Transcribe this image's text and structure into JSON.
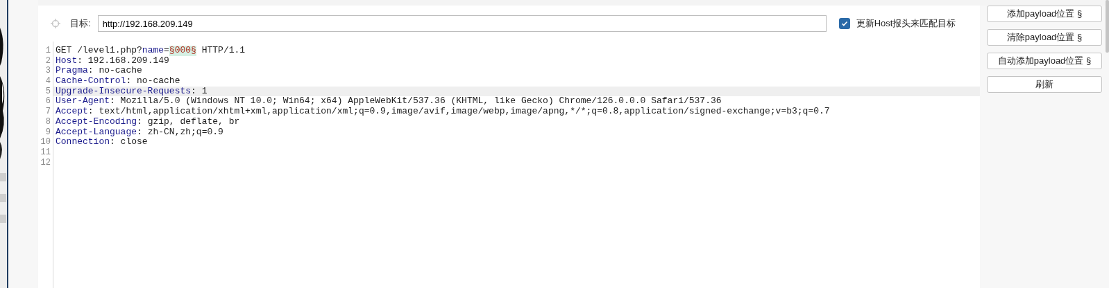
{
  "target": {
    "label": "目标:",
    "value": "http://192.168.209.149"
  },
  "update_host": {
    "label": "更新Host报头来匹配目标",
    "checked": true
  },
  "editor": {
    "lines": [
      {
        "number": "1",
        "selected": false,
        "segments": [
          {
            "kind": "text",
            "text": "GET /level1.php?"
          },
          {
            "kind": "key",
            "text": "name"
          },
          {
            "kind": "text",
            "text": "="
          },
          {
            "kind": "payload",
            "text": "§000§"
          },
          {
            "kind": "text",
            "text": " HTTP/1.1"
          }
        ]
      },
      {
        "number": "2",
        "selected": false,
        "segments": [
          {
            "kind": "key",
            "text": "Host"
          },
          {
            "kind": "text",
            "text": ": 192.168.209.149"
          }
        ]
      },
      {
        "number": "3",
        "selected": false,
        "segments": [
          {
            "kind": "key",
            "text": "Pragma"
          },
          {
            "kind": "text",
            "text": ": no-cache"
          }
        ]
      },
      {
        "number": "4",
        "selected": false,
        "segments": [
          {
            "kind": "key",
            "text": "Cache-Control"
          },
          {
            "kind": "text",
            "text": ": no-cache"
          }
        ]
      },
      {
        "number": "5",
        "selected": true,
        "segments": [
          {
            "kind": "key",
            "text": "Upgrade-Insecure-Requests"
          },
          {
            "kind": "text",
            "text": ": 1"
          }
        ]
      },
      {
        "number": "6",
        "selected": false,
        "segments": [
          {
            "kind": "key",
            "text": "User-Agent"
          },
          {
            "kind": "text",
            "text": ": Mozilla/5.0 (Windows NT 10.0; Win64; x64) AppleWebKit/537.36 (KHTML, like Gecko) Chrome/126.0.0.0 Safari/537.36"
          }
        ]
      },
      {
        "number": "7",
        "selected": false,
        "segments": [
          {
            "kind": "key",
            "text": "Accept"
          },
          {
            "kind": "text",
            "text": ": text/html,application/xhtml+xml,application/xml;q=0.9,image/avif,image/webp,image/apng,*/*;q=0.8,application/signed-exchange;v=b3;q=0.7"
          }
        ]
      },
      {
        "number": "8",
        "selected": false,
        "segments": [
          {
            "kind": "key",
            "text": "Accept-Encoding"
          },
          {
            "kind": "text",
            "text": ": gzip, deflate, br"
          }
        ]
      },
      {
        "number": "9",
        "selected": false,
        "segments": [
          {
            "kind": "key",
            "text": "Accept-Language"
          },
          {
            "kind": "text",
            "text": ": zh-CN,zh;q=0.9"
          }
        ]
      },
      {
        "number": "10",
        "selected": false,
        "segments": [
          {
            "kind": "key",
            "text": "Connection"
          },
          {
            "kind": "text",
            "text": ": close"
          }
        ]
      },
      {
        "number": "11",
        "selected": false
      },
      {
        "number": "12",
        "selected": false
      }
    ]
  },
  "buttons": [
    "添加payload位置 §",
    "清除payload位置 §",
    "自动添加payload位置 §",
    "刷新"
  ]
}
